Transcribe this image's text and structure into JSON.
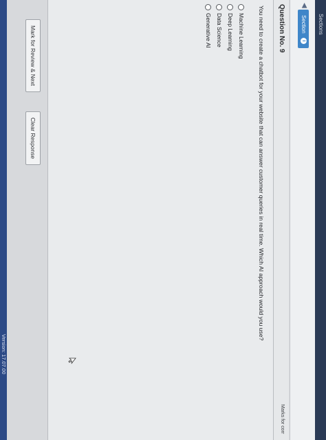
{
  "header": {
    "sections_label": "Sections",
    "section_tab_label": "Section",
    "info_icon": "i"
  },
  "question": {
    "number_label": "Question No. 9",
    "marks_label": "Marks for corr",
    "text": "You need to create a chatbot for your website that can answer customer queries in real time. Which AI approach would you use?",
    "options": [
      {
        "label": "Machine Learning"
      },
      {
        "label": "Deep Learning"
      },
      {
        "label": "Data Science"
      },
      {
        "label": "Generative AI"
      }
    ]
  },
  "footer": {
    "mark_review_label": "Mark for Review & Next",
    "clear_response_label": "Clear Response",
    "version_label": "Version: 17.07.00"
  },
  "colors": {
    "section_tab": "#3f86c9",
    "sections_bar": "#2a3a55",
    "status_strip": "#2c4a86"
  }
}
